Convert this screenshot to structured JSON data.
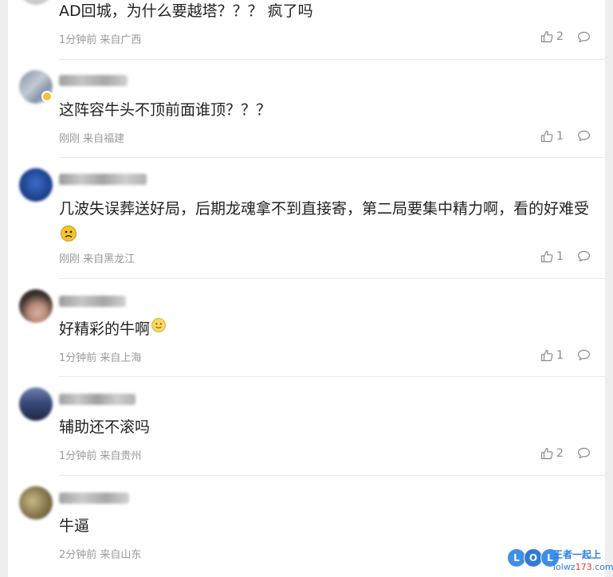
{
  "comments": [
    {
      "text": "AD回城，为什么要越塔？？？ 疯了吗",
      "meta": "1分钟前 来自广西",
      "likes": "2",
      "avatar_colors": [
        "#c9c9c9",
        "#d9d9d9"
      ]
    },
    {
      "text": "这阵容牛头不顶前面谁顶？？？",
      "meta": "刚刚 来自福建",
      "likes": "1",
      "avatar_colors": [
        "#8e9bb0",
        "#c7cbd4"
      ]
    },
    {
      "text": "几波失误葬送好局，后期龙魂拿不到直接寄，第二局要集中精力啊，看的好难受",
      "emoji": "frowning-face",
      "meta": "刚刚 来自黑龙江",
      "likes": "1",
      "avatar_colors": [
        "#1d3f86",
        "#3a66c2"
      ]
    },
    {
      "text": "好精彩的牛啊",
      "emoji": "smiling-face",
      "meta": "1分钟前 来自上海",
      "likes": "1",
      "avatar_colors": [
        "#3c3530",
        "#caa89a"
      ]
    },
    {
      "text": "辅助还不滚吗",
      "meta": "1分钟前 来自贵州",
      "likes": "2",
      "avatar_colors": [
        "#2f3b66",
        "#6f7fa8"
      ]
    },
    {
      "text": "牛逼",
      "meta": "2分钟前 来自山东",
      "likes": "",
      "avatar_colors": [
        "#6c6140",
        "#b7a77a"
      ]
    }
  ],
  "watermark": {
    "badge_letters": [
      "L",
      "O",
      "L"
    ],
    "title": "王者一起上",
    "site_prefix": "lolwz",
    "site_number": "173",
    "site_suffix": ".com",
    "colors": {
      "blue": "#2b7fe0",
      "red": "#e8382f"
    }
  },
  "colors": {
    "text": "#222222",
    "meta": "#999999",
    "icon": "#8a8a8a",
    "divider": "#e8e8e8",
    "page_bg": "#eeeeee",
    "panel_bg": "#ffffff",
    "verified_badge": "#f5c03b",
    "emoji_yellow": "#f4c430"
  }
}
